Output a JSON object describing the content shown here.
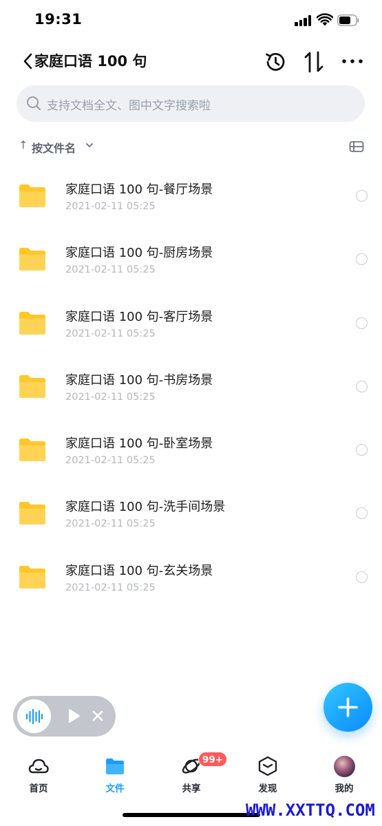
{
  "status_bar": {
    "time": "19:31"
  },
  "header": {
    "title": "家庭口语 100 句"
  },
  "search": {
    "placeholder": "支持文档全文、图中文字搜索啦"
  },
  "sort": {
    "arrow": "↑",
    "label": "按文件名"
  },
  "files": [
    {
      "name": "家庭口语 100 句-餐厅场景",
      "date": "2021-02-11 05:25"
    },
    {
      "name": "家庭口语 100 句-厨房场景",
      "date": "2021-02-11 05:25"
    },
    {
      "name": "家庭口语 100 句-客厅场景",
      "date": "2021-02-11 05:25"
    },
    {
      "name": "家庭口语 100 句-书房场景",
      "date": "2021-02-11 05:25"
    },
    {
      "name": "家庭口语 100 句-卧室场景",
      "date": "2021-02-11 05:25"
    },
    {
      "name": "家庭口语 100 句-洗手间场景",
      "date": "2021-02-11 05:25"
    },
    {
      "name": "家庭口语 100 句-玄关场景",
      "date": "2021-02-11 05:25"
    }
  ],
  "tabs": [
    {
      "label": "首页",
      "icon": "cloud-home-icon"
    },
    {
      "label": "文件",
      "icon": "folder-icon",
      "active": true
    },
    {
      "label": "共享",
      "icon": "share-orbit-icon",
      "badge": "99+"
    },
    {
      "label": "发现",
      "icon": "discover-box-icon"
    },
    {
      "label": "我的",
      "icon": "avatar"
    }
  ],
  "watermark": "WWW.XXTTQ.COM",
  "colors": {
    "accent": "#1a9cff",
    "folder": "#ffcd3c",
    "badge": "#ff5a5a"
  }
}
